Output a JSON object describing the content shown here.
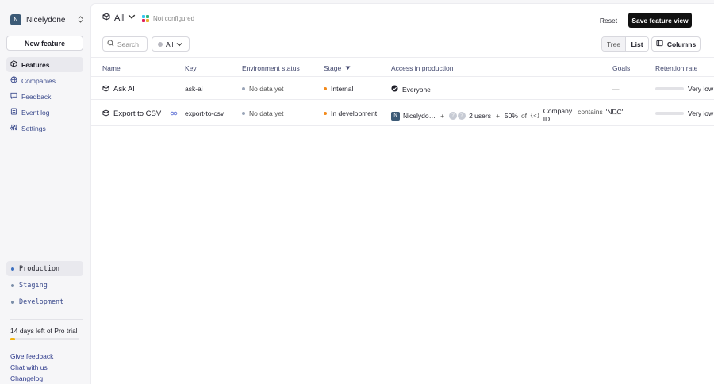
{
  "sidebar": {
    "org": {
      "avatar": "N",
      "name": "Nicelydone"
    },
    "new_feature_label": "New feature",
    "nav": [
      {
        "label": "Features",
        "icon": "features-icon",
        "active": true
      },
      {
        "label": "Companies",
        "icon": "globe-icon",
        "active": false
      },
      {
        "label": "Feedback",
        "icon": "feedback-icon",
        "active": false
      },
      {
        "label": "Event log",
        "icon": "event-log-icon",
        "active": false
      },
      {
        "label": "Settings",
        "icon": "settings-icon",
        "active": false
      }
    ],
    "environments": [
      {
        "label": "Production",
        "active": true
      },
      {
        "label": "Staging",
        "active": false
      },
      {
        "label": "Development",
        "active": false
      }
    ],
    "trial": {
      "text": "14 days left of Pro trial",
      "progress": 0.07,
      "color": "#f2b20b"
    },
    "footer": [
      "Give feedback",
      "Chat with us",
      "Changelog"
    ]
  },
  "topbar": {
    "view_label": "All",
    "slack_status": "Not configured",
    "reset_label": "Reset",
    "save_label": "Save feature view"
  },
  "toolbar": {
    "search_placeholder": "Search",
    "filter_label": "All",
    "tree_label": "Tree",
    "list_label": "List",
    "columns_label": "Columns"
  },
  "table": {
    "headers": {
      "name": "Name",
      "key": "Key",
      "env_status": "Environment status",
      "stage": "Stage",
      "access": "Access in production",
      "goals": "Goals",
      "retention": "Retention rate"
    },
    "rows": [
      {
        "name": "Ask AI",
        "key": "ask-ai",
        "env_status": "No data yet",
        "stage": "Internal",
        "access": "Everyone",
        "goals": "—",
        "retention": "Very low"
      },
      {
        "name": "Export to CSV",
        "key": "export-to-csv",
        "env_status": "No data yet",
        "stage": "In development",
        "access": {
          "company_avatar": "N",
          "company": "Nicelydo…",
          "plus1": "+",
          "user_avatars": [
            "?",
            "?"
          ],
          "users": "2 users",
          "plus2": "+",
          "percent": "50%",
          "of": "of",
          "code_icon": "{<}",
          "attr_line1": "Company",
          "attr_line2": "ID",
          "operator": "contains",
          "value": "'NDC'"
        },
        "goals": "—",
        "retention": "Very low"
      }
    ]
  },
  "colors": {
    "accent": "#111111",
    "link": "#2e3a8c",
    "stage_dot": "#f28a1c",
    "avatar": "#3c5a76"
  }
}
